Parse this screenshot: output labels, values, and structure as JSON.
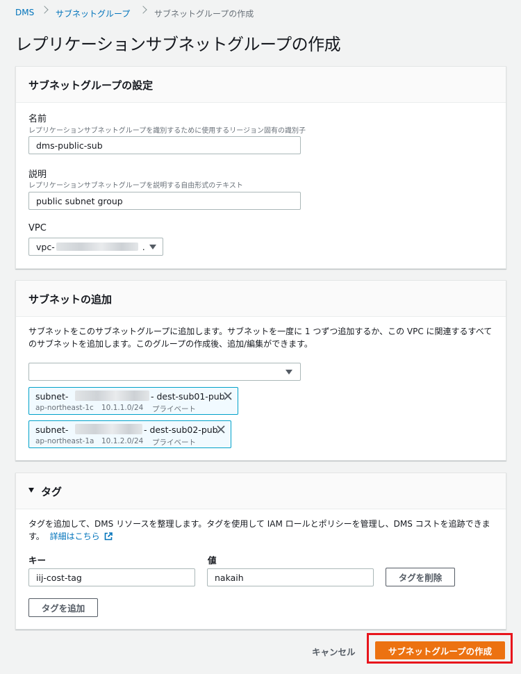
{
  "breadcrumb": {
    "items": [
      "DMS",
      "サブネットグループ",
      "サブネットグループの作成"
    ]
  },
  "page": {
    "title": "レプリケーションサブネットグループの作成"
  },
  "settings_panel": {
    "title": "サブネットグループの設定",
    "name_label": "名前",
    "name_hint": "レプリケーションサブネットグループを識別するために使用するリージョン固有の識別子",
    "name_value": "dms-public-sub",
    "desc_label": "説明",
    "desc_hint": "レプリケーションサブネットグループを説明する自由形式のテキスト",
    "desc_value": "public subnet group",
    "vpc_label": "VPC",
    "vpc_value_prefix": "vpc-",
    "vpc_value_suffix": "."
  },
  "subnets_panel": {
    "title": "サブネットの追加",
    "description": "サブネットをこのサブネットグループに追加します。サブネットを一度に 1 つずつ追加するか、この VPC に関連するすべてのサブネットを追加します。このグループの作成後、追加/編集ができます。",
    "selected": [
      {
        "prefix": "subnet-",
        "name": "- dest-sub01-pub",
        "az": "ap-northeast-1c",
        "cidr": "10.1.1.0/24",
        "type": "プライベート"
      },
      {
        "prefix": "subnet-",
        "name": "- dest-sub02-pub",
        "az": "ap-northeast-1a",
        "cidr": "10.1.2.0/24",
        "type": "プライベート"
      }
    ]
  },
  "tags_panel": {
    "title": "タグ",
    "description": "タグを追加して、DMS リソースを整理します。タグを使用して IAM ロールとポリシーを管理し、DMS コストを追跡できます。",
    "learn_more": "詳細はこちら",
    "key_label": "キー",
    "value_label": "値",
    "key_value": "iij-cost-tag",
    "value_value": "nakaih",
    "remove_button": "タグを削除",
    "add_button": "タグを追加"
  },
  "footer": {
    "cancel": "キャンセル",
    "create": "サブネットグループの作成",
    "highlight_color": "#e8141c"
  },
  "colors": {
    "primary": "#ec7211",
    "link": "#0073bb",
    "token_border": "#00a1c9"
  }
}
